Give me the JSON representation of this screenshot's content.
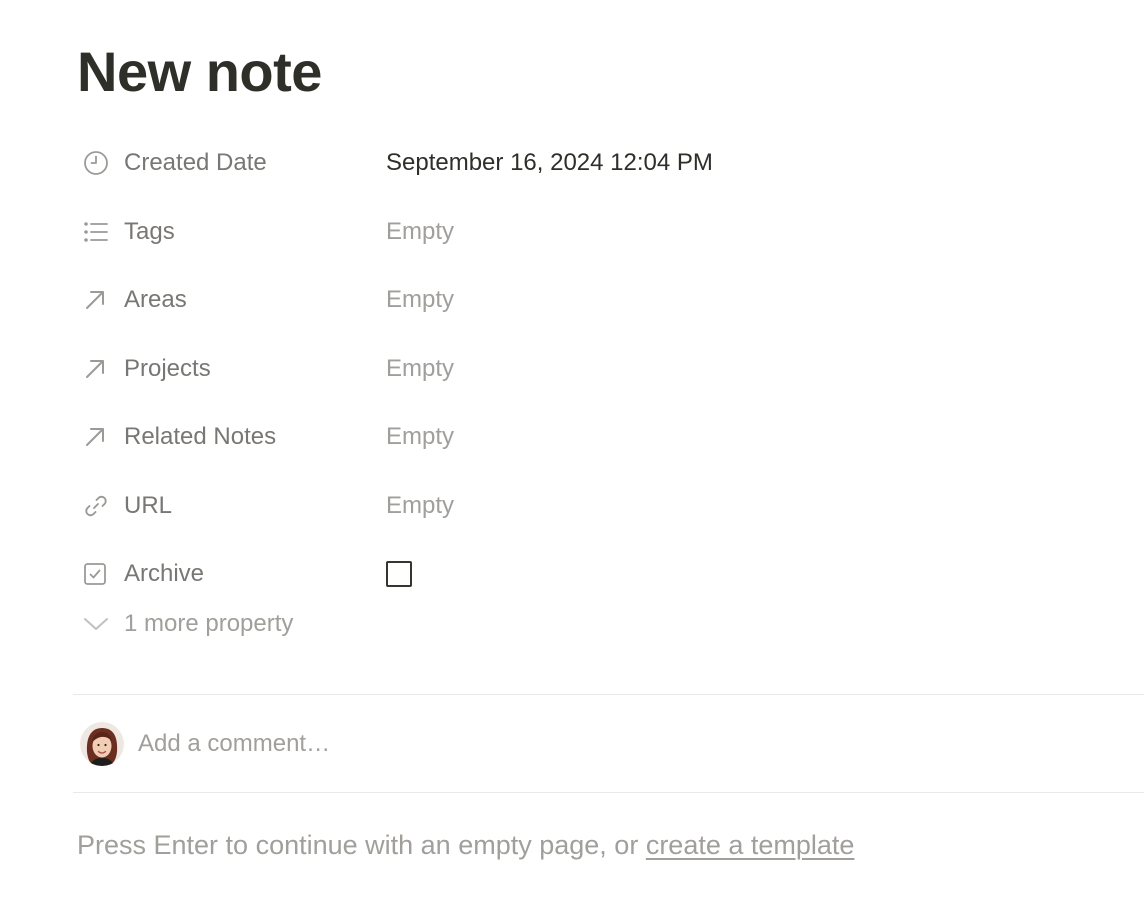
{
  "page": {
    "title": "New note"
  },
  "properties": [
    {
      "icon": "clock-icon",
      "label": "Created Date",
      "value": "September 16, 2024 12:04 PM",
      "state": "filled"
    },
    {
      "icon": "list-icon",
      "label": "Tags",
      "value": "Empty",
      "state": "empty"
    },
    {
      "icon": "arrow-up-right-icon",
      "label": "Areas",
      "value": "Empty",
      "state": "empty"
    },
    {
      "icon": "arrow-up-right-icon",
      "label": "Projects",
      "value": "Empty",
      "state": "empty"
    },
    {
      "icon": "arrow-up-right-icon",
      "label": "Related Notes",
      "value": "Empty",
      "state": "empty"
    },
    {
      "icon": "link-icon",
      "label": "URL",
      "value": "Empty",
      "state": "empty"
    },
    {
      "icon": "checkbox-icon",
      "label": "Archive",
      "value": "",
      "checked": false
    }
  ],
  "more_properties": {
    "icon": "chevron-down-icon",
    "label": "1 more property"
  },
  "comment": {
    "avatar": "user-avatar",
    "placeholder": "Add a comment…"
  },
  "hint": {
    "text": "Press Enter to continue with an empty page, or ",
    "link_label": "create a template"
  },
  "colors": {
    "text_primary": "#2f2f2a",
    "text_secondary": "#787774",
    "text_placeholder": "#a19f9b",
    "divider": "#e9e9e7"
  }
}
